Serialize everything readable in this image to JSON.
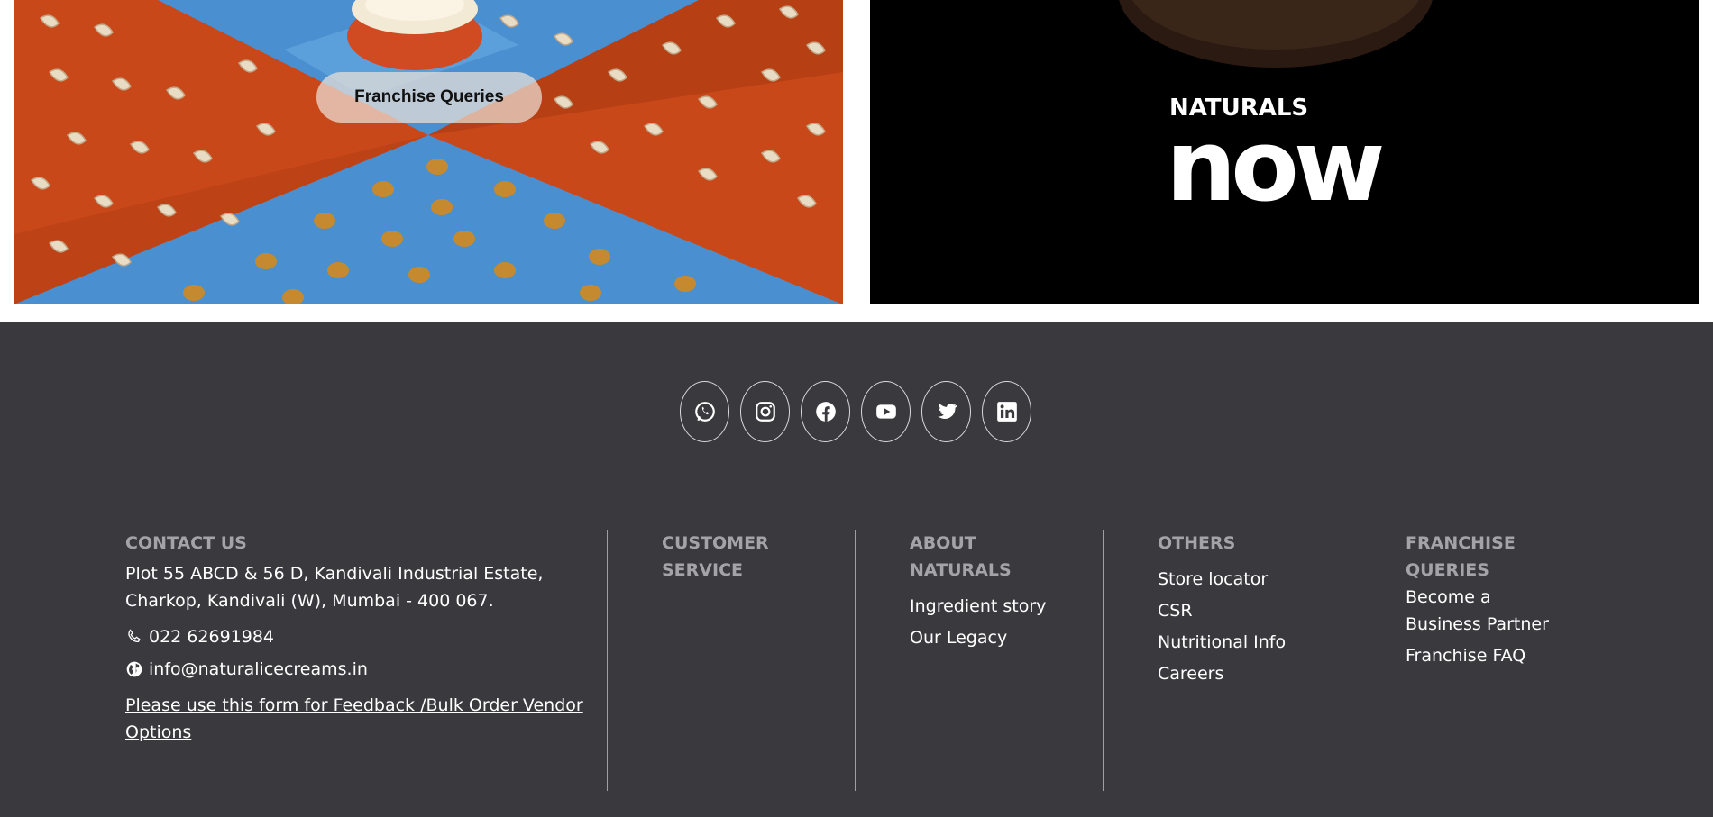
{
  "hero": {
    "franchise_button": "Franchise Queries",
    "brand_logo_top": "NATURALS",
    "brand_logo_bottom": "now"
  },
  "social": [
    {
      "name": "whatsapp-icon"
    },
    {
      "name": "instagram-icon"
    },
    {
      "name": "facebook-icon"
    },
    {
      "name": "youtube-icon"
    },
    {
      "name": "twitter-icon"
    },
    {
      "name": "linkedin-icon"
    }
  ],
  "footer": {
    "contact": {
      "heading": "CONTACT US",
      "address": "Plot 55 ABCD & 56 D, Kandivali Industrial Estate, Charkop, Kandivali (W), Mumbai - 400 067.",
      "phone": "022 62691984",
      "email": "info@naturalicecreams.in",
      "form_link": "Please use this form for Feedback /Bulk Order Vendor Options"
    },
    "customer_service": {
      "heading": "CUSTOMER SERVICE"
    },
    "about": {
      "heading": "ABOUT NATURALS",
      "links": [
        "Ingredient story",
        "Our Legacy"
      ]
    },
    "others": {
      "heading": "OTHERS",
      "links": [
        "Store locator",
        "CSR",
        "Nutritional Info",
        "Careers"
      ]
    },
    "franchise": {
      "heading": "FRANCHISE QUERIES",
      "links": [
        "Become a Business Partner",
        "Franchise FAQ"
      ]
    }
  },
  "colors": {
    "footer_bg": "#3a393e",
    "orange": "#c8481a",
    "blue": "#4a8fcf",
    "heading_grey": "#a3a3a8"
  }
}
